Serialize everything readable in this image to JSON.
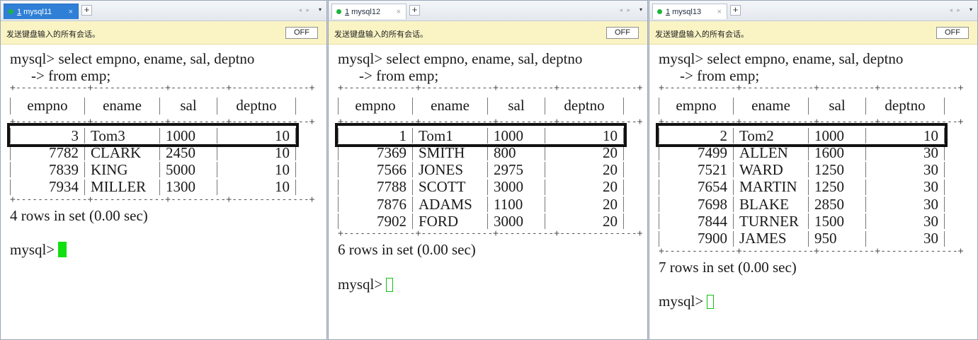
{
  "broadcast_message": "发送键盘输入的所有会话。",
  "off_label": "OFF",
  "new_tab_label": "+",
  "close_label": "×",
  "scroll_arrows": "◂ ▸",
  "menu_glyph": "▾",
  "prompt": "mysql>",
  "query_line1": "select empno, ename, sal, deptno",
  "query_line2": "-> from emp;",
  "columns": [
    "empno",
    "ename",
    "sal",
    "deptno"
  ],
  "colors": {
    "active_tab": "#2f7fd7",
    "broadcast_bar": "#faf4c4",
    "session_dot": "#1bb53a",
    "cursor": "#10e010"
  },
  "panes": [
    {
      "tab_number": "1",
      "tab_name": "mysql11",
      "tab_active": true,
      "cursor_style": "solid",
      "result_text": "4 rows in set (0.00 sec)",
      "rows": [
        [
          "3",
          "Tom3",
          "1000",
          "10"
        ],
        [
          "7782",
          "CLARK",
          "2450",
          "10"
        ],
        [
          "7839",
          "KING",
          "5000",
          "10"
        ],
        [
          "7934",
          "MILLER",
          "1300",
          "10"
        ]
      ]
    },
    {
      "tab_number": "1",
      "tab_name": "mysql12",
      "tab_active": false,
      "cursor_style": "hollow",
      "result_text": "6 rows in set (0.00 sec)",
      "rows": [
        [
          "1",
          "Tom1",
          "1000",
          "10"
        ],
        [
          "7369",
          "SMITH",
          "800",
          "20"
        ],
        [
          "7566",
          "JONES",
          "2975",
          "20"
        ],
        [
          "7788",
          "SCOTT",
          "3000",
          "20"
        ],
        [
          "7876",
          "ADAMS",
          "1100",
          "20"
        ],
        [
          "7902",
          "FORD",
          "3000",
          "20"
        ]
      ]
    },
    {
      "tab_number": "1",
      "tab_name": "mysql13",
      "tab_active": false,
      "cursor_style": "hollow",
      "result_text": "7 rows in set (0.00 sec)",
      "rows": [
        [
          "2",
          "Tom2",
          "1000",
          "10"
        ],
        [
          "7499",
          "ALLEN",
          "1600",
          "30"
        ],
        [
          "7521",
          "WARD",
          "1250",
          "30"
        ],
        [
          "7654",
          "MARTIN",
          "1250",
          "30"
        ],
        [
          "7698",
          "BLAKE",
          "2850",
          "30"
        ],
        [
          "7844",
          "TURNER",
          "1500",
          "30"
        ],
        [
          "7900",
          "JAMES",
          "950",
          "30"
        ]
      ]
    }
  ]
}
